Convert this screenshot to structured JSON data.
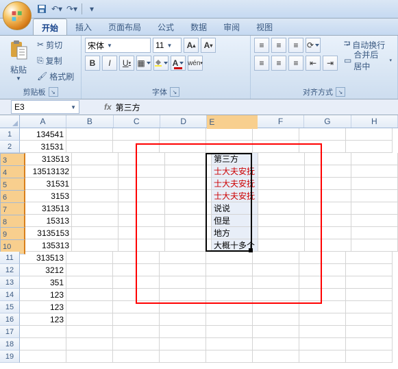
{
  "qat": {
    "save": "保存",
    "undo": "撤销",
    "redo": "重做"
  },
  "tabs": [
    "开始",
    "插入",
    "页面布局",
    "公式",
    "数据",
    "审阅",
    "视图"
  ],
  "active_tab": 0,
  "ribbon": {
    "clipboard": {
      "paste": "粘贴",
      "cut": "剪切",
      "copy": "复制",
      "fmtpaint": "格式刷",
      "label": "剪贴板"
    },
    "font": {
      "name": "宋体",
      "size": "11",
      "label": "字体"
    },
    "align": {
      "wrap": "自动换行",
      "merge": "合并后居中",
      "label": "对齐方式"
    }
  },
  "namebox": "E3",
  "formula": "第三方",
  "columns": [
    "A",
    "B",
    "C",
    "D",
    "E",
    "F",
    "G",
    "H"
  ],
  "col_a": [
    "134541",
    "31531",
    "313513",
    "13513132",
    "31531",
    "3153",
    "313513",
    "15313",
    "3135153",
    "135313",
    "313513",
    "3212",
    "351",
    "123",
    "123",
    "123",
    "",
    "",
    ""
  ],
  "col_e": [
    "",
    "",
    "第三方",
    "士大夫安抚",
    "士大夫安抚",
    "士大夫安抚",
    "说说",
    "但是",
    "地方",
    "大概十多个",
    "",
    "",
    "",
    "",
    "",
    "",
    "",
    "",
    ""
  ],
  "e_red": [
    false,
    false,
    false,
    true,
    true,
    true,
    false,
    false,
    false,
    false,
    false,
    false,
    false,
    false,
    false,
    false,
    false,
    false,
    false
  ],
  "chart_data": {
    "type": "table",
    "title": "",
    "series": [
      {
        "name": "A",
        "values": [
          134541,
          31531,
          313513,
          13513132,
          31531,
          3153,
          313513,
          15313,
          3135153,
          135313,
          313513,
          3212,
          351,
          123,
          123,
          123
        ]
      },
      {
        "name": "E",
        "values": [
          "第三方",
          "士大夫安抚",
          "士大夫安抚",
          "士大夫安抚",
          "说说",
          "但是",
          "地方",
          "大概十多个"
        ]
      }
    ]
  }
}
